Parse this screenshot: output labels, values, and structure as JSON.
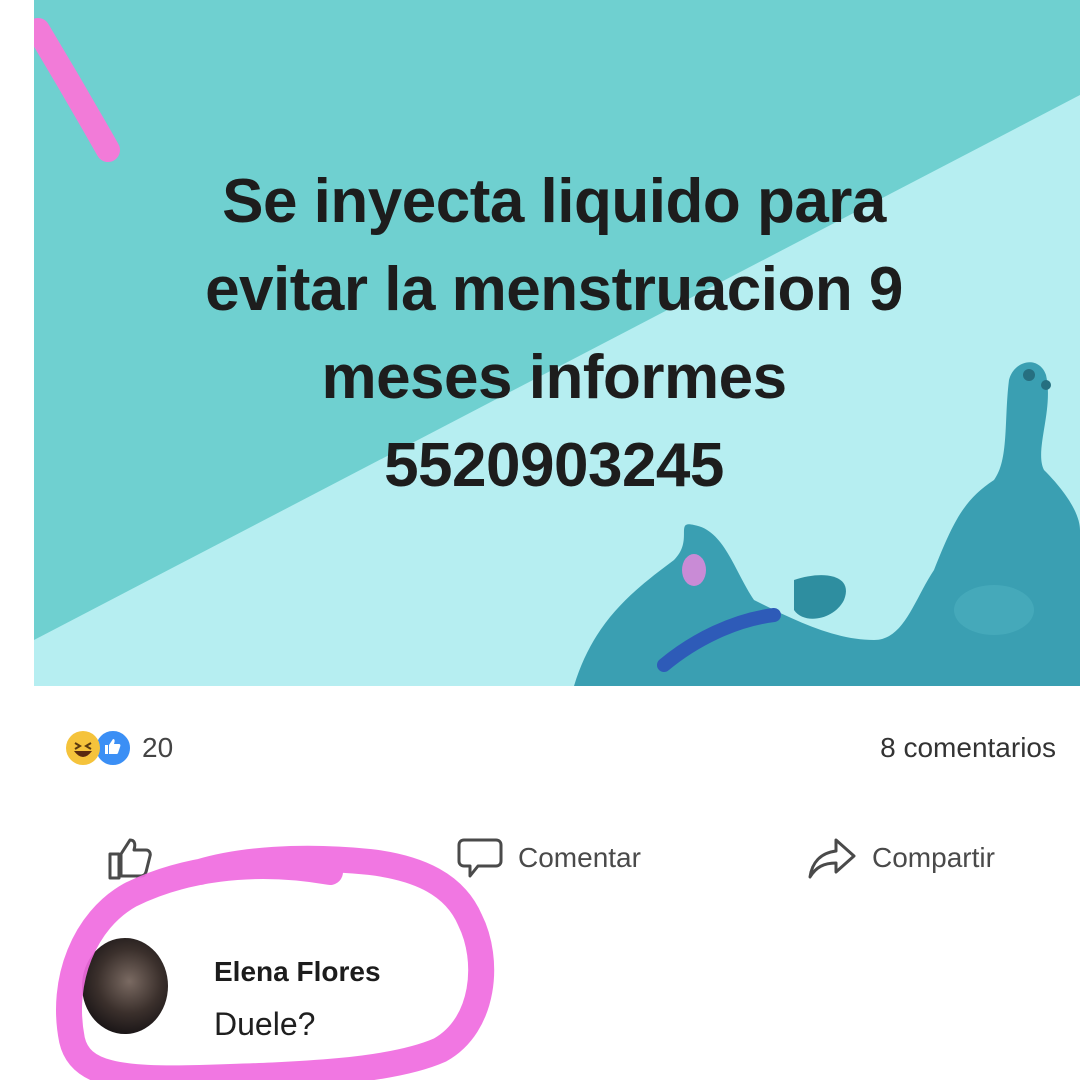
{
  "post": {
    "headline_lines": [
      "Se inyecta liquido para",
      "evitar la menstruacion 9",
      "meses informes",
      "5520903245"
    ]
  },
  "stats": {
    "reaction_icons": [
      "haha-reaction-icon",
      "like-reaction-icon"
    ],
    "reaction_count": "20",
    "comments_count": "8 comentarios"
  },
  "actions": {
    "like_label": "",
    "comment_label": "Comentar",
    "share_label": "Compartir"
  },
  "comment": {
    "author": "Elena Flores",
    "text": "Duele?"
  },
  "colors": {
    "image_bg_dark": "#6fcfcf",
    "image_bg_light": "#b5eef0",
    "dog_body": "#3a9fb2",
    "collar": "#2e5bb8",
    "highlight_marker": "#f06be0"
  }
}
